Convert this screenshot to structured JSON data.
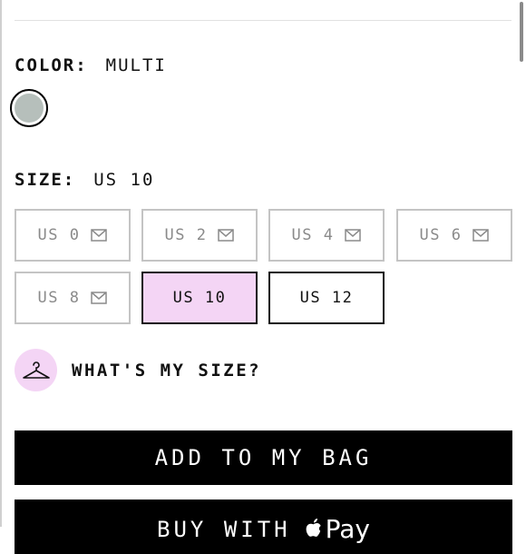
{
  "colors": {
    "accent_pink": "#f4d5f5",
    "swatch": "#b6bfbb",
    "black": "#000000"
  },
  "color_section": {
    "label": "COLOR:",
    "value": "MULTI",
    "swatch_name": "Multi"
  },
  "size_section": {
    "label": "SIZE:",
    "value": "US 10",
    "options": [
      {
        "label": "US 0",
        "available": false
      },
      {
        "label": "US 2",
        "available": false
      },
      {
        "label": "US 4",
        "available": false
      },
      {
        "label": "US 6",
        "available": false
      },
      {
        "label": "US 8",
        "available": false
      },
      {
        "label": "US 10",
        "available": true,
        "selected": true
      },
      {
        "label": "US 12",
        "available": true
      }
    ]
  },
  "fit_help": {
    "label": "WHAT'S MY SIZE?",
    "icon": "hanger-icon"
  },
  "actions": {
    "add_to_bag": "ADD TO MY BAG",
    "buy_with": "BUY WITH",
    "pay": "Pay",
    "pay_icon": "apple-icon"
  },
  "unavailable_icon": "mail-icon"
}
